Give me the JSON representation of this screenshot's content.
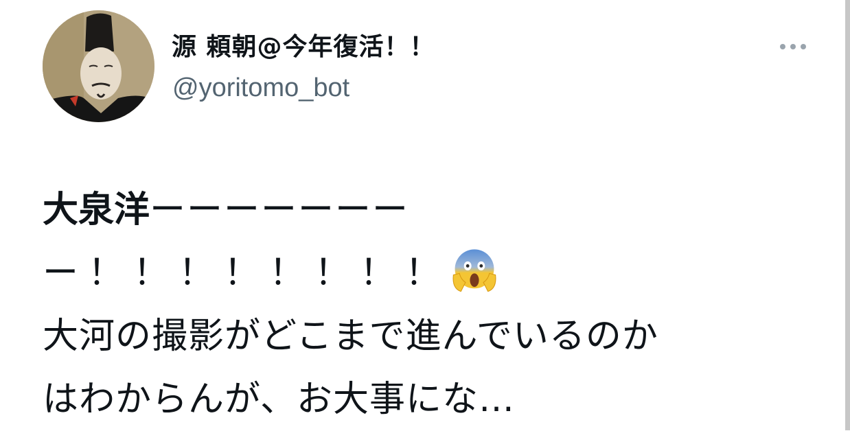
{
  "tweet": {
    "author": {
      "display_name": "源 頼朝@今年復活！！",
      "handle": "@yoritomo_bot",
      "avatar_icon": "portrait-avatar"
    },
    "more_icon": "more-dots-icon",
    "text_lines": [
      {
        "bold": "大泉洋",
        "rest": "ーーーーーーー"
      },
      {
        "text": "ー！！！！！！！！"
      },
      {
        "text": "大河の撮影がどこまで進んでいるのか"
      },
      {
        "text": "はわからんが、お大事にな…"
      }
    ],
    "emoji": "face-screaming-in-fear-emoji"
  },
  "colors": {
    "text_primary": "#0f1419",
    "text_secondary": "#536471",
    "more_dots": "#9aa4ad",
    "emoji_face": "#f4c534",
    "emoji_forehead": "#5b8fd6"
  }
}
